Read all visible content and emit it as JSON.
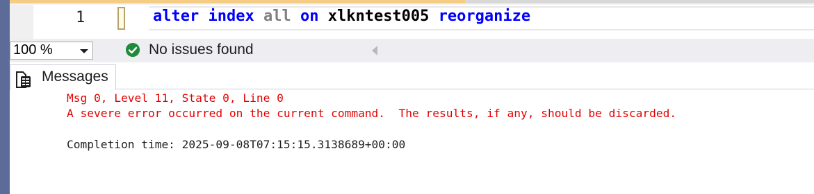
{
  "editor": {
    "line_number": "1",
    "code_tokens": [
      {
        "text": "alter",
        "style": "kw"
      },
      {
        "text": " ",
        "style": "plain"
      },
      {
        "text": "index",
        "style": "kw"
      },
      {
        "text": " ",
        "style": "plain"
      },
      {
        "text": "all",
        "style": "fn"
      },
      {
        "text": " ",
        "style": "plain"
      },
      {
        "text": "on",
        "style": "kw"
      },
      {
        "text": " ",
        "style": "plain"
      },
      {
        "text": "xlkntest005",
        "style": "plain"
      },
      {
        "text": " ",
        "style": "plain"
      },
      {
        "text": "reorganize",
        "style": "kw"
      }
    ]
  },
  "statusbar": {
    "zoom": "100 %",
    "issues_text": "No issues found",
    "ok_icon": "check-circle-icon"
  },
  "results": {
    "tab_label": "Messages",
    "tab_icon": "messages-icon",
    "messages": [
      {
        "text": "Msg 0, Level 11, State 0, Line 0",
        "kind": "err"
      },
      {
        "text": "A severe error occurred on the current command.  The results, if any, should be discarded.",
        "kind": "err"
      },
      {
        "text": "",
        "kind": "norm"
      },
      {
        "text": "Completion time: 2025-09-08T07:15:15.3138689+00:00",
        "kind": "norm"
      }
    ]
  },
  "colors": {
    "keyword": "#0000ff",
    "function": "#808080",
    "error": "#e40000",
    "accent_strip": "#5d6b99",
    "ok": "#1e8a3a"
  }
}
